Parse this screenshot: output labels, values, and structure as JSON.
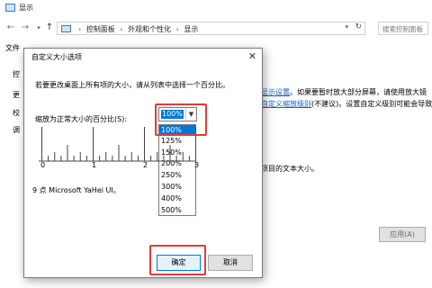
{
  "window": {
    "title": "显示"
  },
  "address": {
    "crumbs": [
      "控制面板",
      "外观和个性化",
      "显示"
    ],
    "search_placeholder": "搜索控制面板"
  },
  "menubar": {
    "label": "文件"
  },
  "background_text": {
    "side": [
      "控",
      "更",
      "校",
      "调"
    ],
    "link_display_settings": "显示设置",
    "line1_after": "。如果要暂时放大部分屏幕，请使用放大镜",
    "line1_link": "放大镜",
    "line1_end": "。如",
    "link_custom_zoom": "自定义缩放级别",
    "line2_after": "(不建议)。设置自定义级别可能会导致在某",
    "line3": "项目的文本大小。",
    "apply_button": "应用(A)"
  },
  "dialog": {
    "title": "自定义大小选项",
    "instruction": "若要更改桌面上所有项的大小，请从列表中选择一个百分比。",
    "scale_label": "缩放为正常大小的百分比(S):",
    "selected_value": "100%",
    "options": [
      "100%",
      "125%",
      "150%",
      "200%",
      "250%",
      "300%",
      "400%",
      "500%"
    ],
    "ruler_labels": [
      "0",
      "1",
      "2",
      "3"
    ],
    "font_info": "9 点 Microsoft YaHei UI。",
    "ok_label": "确定",
    "cancel_label": "取消",
    "highlight_color": "#e13b3b",
    "selection_color": "#0078d7"
  }
}
